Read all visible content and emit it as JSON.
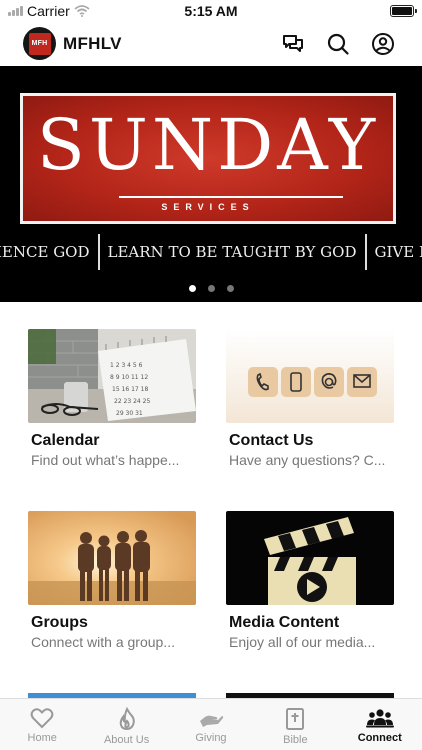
{
  "status_bar": {
    "carrier": "Carrier",
    "time": "5:15 AM",
    "battery_level": 0.9
  },
  "header": {
    "logo_text": "MFH",
    "title": "MFHLV",
    "icons": [
      "chat-icon",
      "search-icon",
      "account-icon"
    ]
  },
  "banner": {
    "title": "SUNDAY",
    "subtitle": "SERVICES",
    "ticker": [
      "IENCE GOD",
      "LEARN TO BE TAUGHT BY GOD",
      "GIVE BACK T"
    ],
    "active_slide": 1,
    "slide_count": 3
  },
  "cards": [
    {
      "title": "Calendar",
      "description": "Find out what’s happe..."
    },
    {
      "title": "Contact Us",
      "description": "Have any questions? C..."
    },
    {
      "title": "Groups",
      "description": "Connect with a group..."
    },
    {
      "title": "Media Content",
      "description": "Enjoy all of our media..."
    }
  ],
  "tabs": [
    {
      "label": "Home",
      "icon": "heart-icon"
    },
    {
      "label": "About Us",
      "icon": "flame-icon"
    },
    {
      "label": "Giving",
      "icon": "hand-icon"
    },
    {
      "label": "Bible",
      "icon": "bible-icon"
    },
    {
      "label": "Connect",
      "icon": "people-icon",
      "active": true
    }
  ],
  "colors": {
    "accent": "#111111",
    "banner_red": "#c0281d",
    "muted": "#999999"
  }
}
